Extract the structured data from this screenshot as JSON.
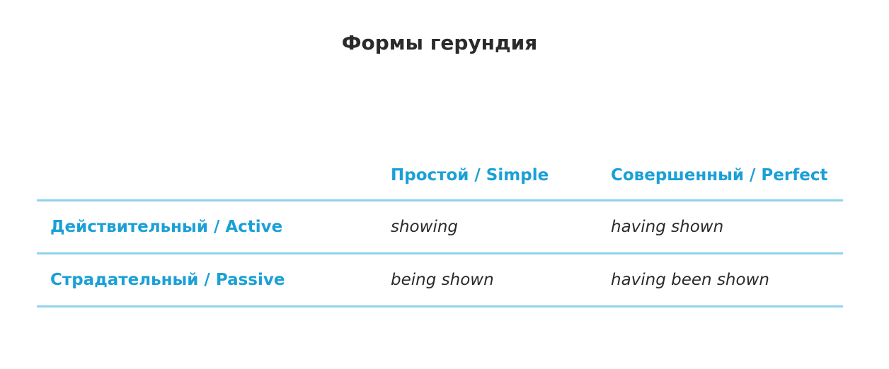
{
  "title": "Формы герундия",
  "colors": {
    "accent": "#1ba0d6",
    "rule": "#8fd3ee",
    "text": "#2b2b2b"
  },
  "table": {
    "headers": [
      "",
      "Простой / Simple",
      "Совершенный / Perfect"
    ],
    "rows": [
      {
        "label": "Действительный / Active",
        "simple": "showing",
        "perfect": "having shown"
      },
      {
        "label": "Страдательный / Passive",
        "simple": "being shown",
        "perfect": "having been shown"
      }
    ]
  }
}
